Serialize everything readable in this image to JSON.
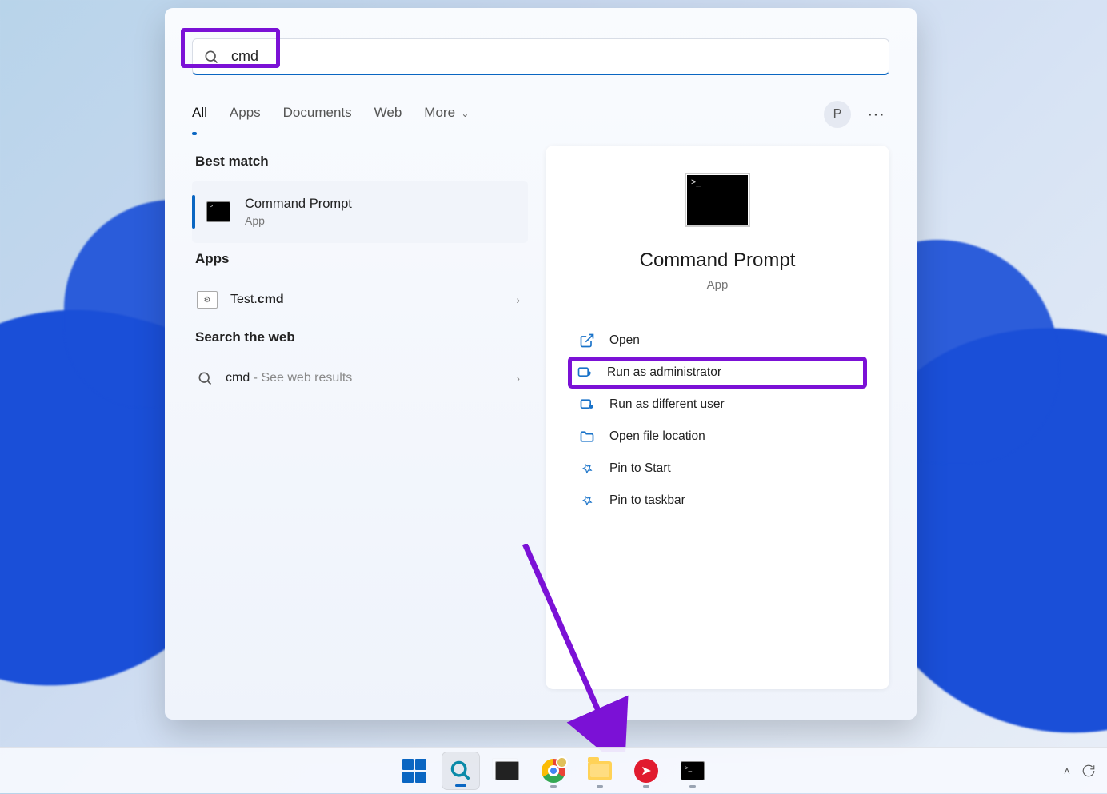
{
  "search": {
    "query": "cmd"
  },
  "tabs": {
    "items": [
      "All",
      "Apps",
      "Documents",
      "Web",
      "More"
    ],
    "active": 0,
    "avatar_initial": "P"
  },
  "sections": {
    "best_match": "Best match",
    "apps": "Apps",
    "web": "Search the web"
  },
  "results": {
    "best": {
      "title": "Command Prompt",
      "subtitle": "App"
    },
    "apps": {
      "label_prefix": "Test.",
      "label_bold": "cmd"
    },
    "web": {
      "term": "cmd",
      "suffix": " - See web results"
    }
  },
  "detail": {
    "title": "Command Prompt",
    "subtitle": "App",
    "actions": {
      "open": "Open",
      "run_admin": "Run as administrator",
      "run_diff": "Run as different user",
      "open_loc": "Open file location",
      "pin_start": "Pin to Start",
      "pin_taskbar": "Pin to taskbar"
    }
  },
  "taskbar": {
    "items": [
      "start",
      "search",
      "task-view",
      "chrome",
      "explorer",
      "lips",
      "cmd"
    ]
  }
}
